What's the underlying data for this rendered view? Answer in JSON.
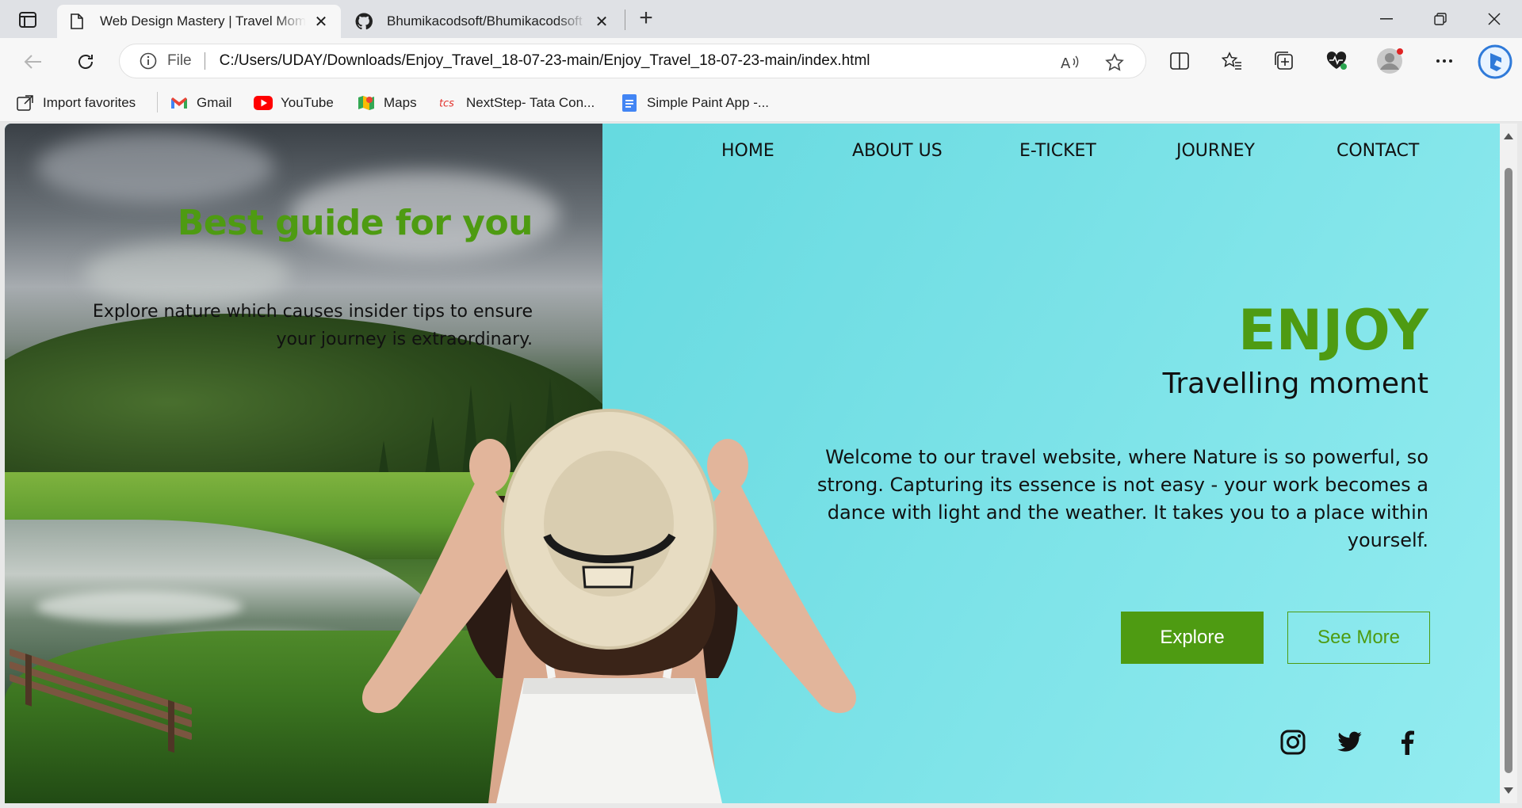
{
  "browser": {
    "tabs": [
      {
        "title": "Web Design Mastery | Travel Moment",
        "icon": "page-icon",
        "active": true
      },
      {
        "title": "Bhumikacodsoft/Bhumikacodsoft",
        "icon": "github-icon",
        "active": false
      }
    ],
    "address": {
      "scheme_label": "File",
      "url": "C:/Users/UDAY/Downloads/Enjoy_Travel_18-07-23-main/Enjoy_Travel_18-07-23-main/index.html"
    },
    "bookmarks": [
      {
        "label": "Import favorites",
        "icon": "import-icon"
      },
      {
        "label": "Gmail",
        "icon": "gmail-icon"
      },
      {
        "label": "YouTube",
        "icon": "youtube-icon"
      },
      {
        "label": "Maps",
        "icon": "maps-icon"
      },
      {
        "label": "NextStep- Tata Con...",
        "icon": "tcs-icon"
      },
      {
        "label": "Simple Paint App -...",
        "icon": "docs-icon"
      }
    ]
  },
  "page": {
    "nav": [
      "HOME",
      "ABOUT US",
      "E-TICKET",
      "JOURNEY",
      "CONTACT"
    ],
    "left_title": "Best guide for you",
    "left_text": "Explore nature which causes insider tips to ensure your journey is extraordinary.",
    "hero_title": "ENJOY",
    "hero_subtitle": "Travelling moment",
    "hero_text": "Welcome to our travel website, where Nature is so powerful, so strong. Capturing its essence is not easy - your work becomes a dance with light and the weather. It takes you to a place within yourself.",
    "buttons": {
      "explore": "Explore",
      "see_more": "See More"
    },
    "social": [
      "instagram-icon",
      "twitter-icon",
      "facebook-icon"
    ],
    "colors": {
      "accent": "#4e9b12",
      "bg_start": "#4ed3d9",
      "bg_end": "#93ecf0"
    }
  }
}
